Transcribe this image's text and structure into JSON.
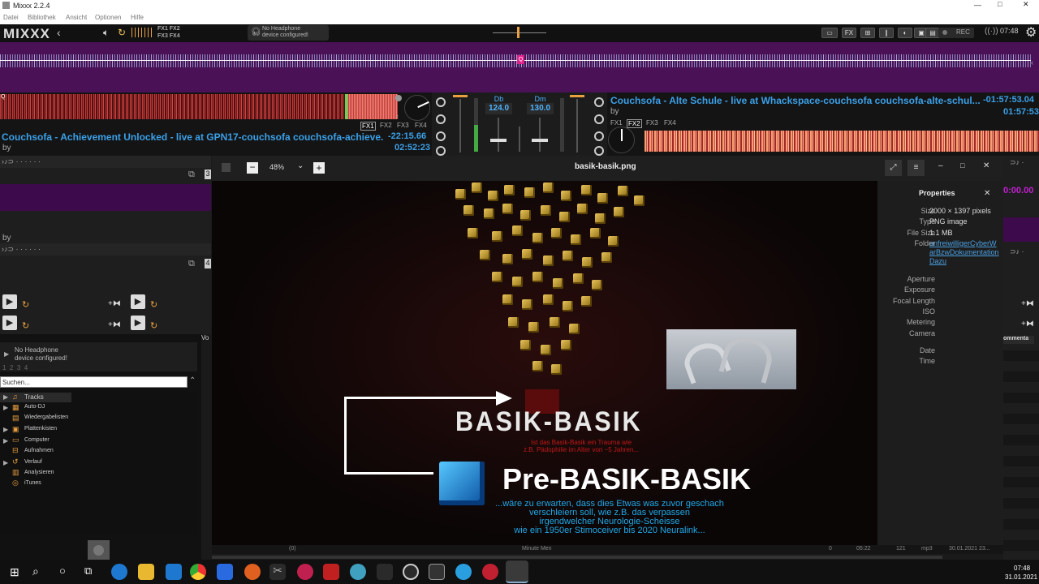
{
  "window": {
    "title": "Mixxx 2.2.4"
  },
  "menu": [
    "Datei",
    "Bibliothek",
    "Ansicht",
    "Optionen",
    "Hilfe"
  ],
  "topbar": {
    "logo": "MIXXX",
    "fx_top": "FX1 FX2",
    "fx_bottom": "FX3 FX4",
    "headphone_line1": "No Headphone",
    "headphone_line2": "device configured!",
    "fx_button": "FX",
    "rec_label": "REC",
    "clock": "07:48"
  },
  "deck1": {
    "title": "Couchsofa - Achievement Unlocked - live at GPN17-couchsofa couchsofa-achieve...",
    "remaining": "-22:15.66",
    "duration": "02:52:23",
    "by": "by",
    "fx": [
      "FX1",
      "FX2",
      "FX3",
      "FX4"
    ]
  },
  "deck2": {
    "title": "Couchsofa - Alte Schule - live at Whackspace-couchsofa couchsofa-alte-schul...",
    "remaining": "-01:57:53.04",
    "duration": "01:57:53",
    "by": "by",
    "fx": [
      "FX1",
      "FX2",
      "FX3",
      "FX4"
    ]
  },
  "mixer": {
    "key_left": "Db",
    "bpm_left": "124.0",
    "key_right": "Dm",
    "bpm_right": "130.0"
  },
  "deck3": {
    "by": "by",
    "num": "3"
  },
  "deck4": {
    "num": "4"
  },
  "right_deck": {
    "time": "0:00.00",
    "col_header": "ommenta"
  },
  "library": {
    "headphone_line1": "No Headphone",
    "headphone_line2": "device configured!",
    "pages": [
      "1",
      "2",
      "3",
      "4"
    ],
    "search_placeholder": "Suchen...",
    "tree": [
      "Tracks",
      "Auto-DJ",
      "Wiedergabelisten",
      "Plattenkisten",
      "Computer",
      "Aufnahmen",
      "Verlauf",
      "Analysieren",
      "iTunes"
    ],
    "col_header": "Vo"
  },
  "viewer": {
    "zoom": "48%",
    "filename": "basik-basik.png",
    "panel_title": "Properties",
    "props": [
      {
        "k": "Size",
        "v": "2000 × 1397 pixels"
      },
      {
        "k": "Type",
        "v": "PNG image"
      },
      {
        "k": "File Size",
        "v": "1.1 MB"
      },
      {
        "k": "Folder",
        "v": "unfreiwilligerCyberWarBzwDokumentationDazu"
      }
    ],
    "exif": [
      "Aperture",
      "Exposure",
      "Focal Length",
      "ISO",
      "Metering",
      "Camera"
    ],
    "dates": [
      "Date",
      "Time"
    ],
    "image_text": {
      "heading1": "BASIK-BASIK",
      "sub_line1": "Ist das Basik-Basik ein Trauma wie",
      "sub_line2": "z.B. Pädophilie im Alter von ~5 Jahren...",
      "heading2": "Pre-BASIK-BASIK",
      "desc": [
        "...wäre zu erwarten, dass dies Etwas was zuvor geschach",
        "verschleiern soll, wie z.B. das verpassen",
        "irgendwelcher Neurologie-Scheisse",
        "wie ein 1950er Stimoceiver bis 2020 Neuralink..."
      ]
    }
  },
  "status_row": {
    "c1": "(0)",
    "c2": "Minute Men",
    "c3": "0",
    "c4": "05:22",
    "c5": "121",
    "c6": "mp3",
    "c7": "30.01.2021 23..."
  },
  "taskbar": {
    "time": "07:48",
    "date": "31.01.2021"
  },
  "colors": {
    "accent": "#3ba0e8",
    "purple": "#4a1157",
    "waveform": "#e0604a",
    "bpm": "#4cb3ff"
  }
}
